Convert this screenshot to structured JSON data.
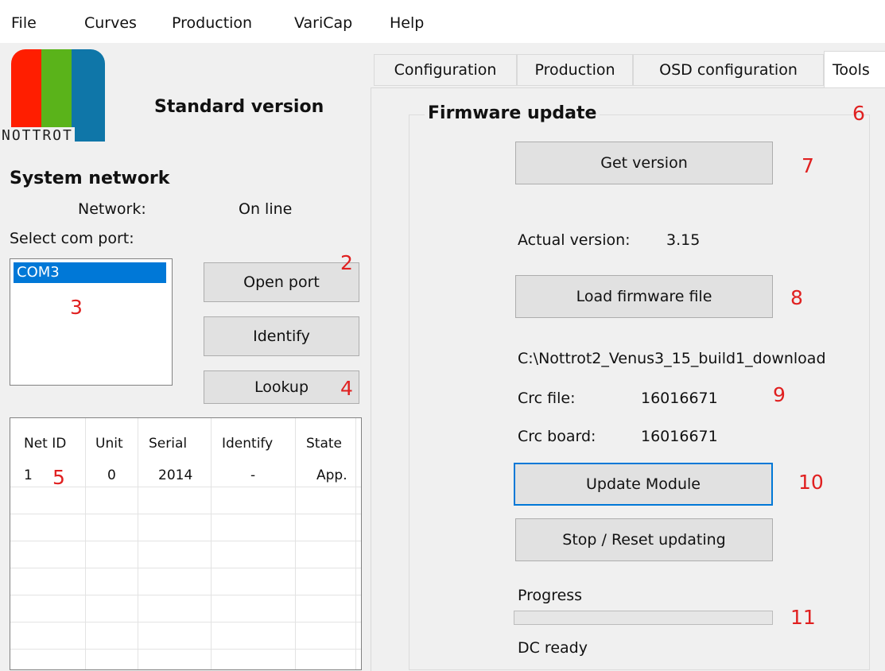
{
  "menu": {
    "items": [
      "File",
      "Curves",
      "Production",
      "VariCap",
      "Help"
    ]
  },
  "logo": {
    "text": "NOTTROT",
    "colors": [
      "#ff1e00",
      "#5ab31a",
      "#0f76a8"
    ]
  },
  "header": {
    "version_label": "Standard version"
  },
  "system_network": {
    "title": "System network",
    "network_label": "Network:",
    "network_status": "On line",
    "select_port_label": "Select com port:",
    "com_ports": [
      "COM3"
    ],
    "selected_port": "COM3",
    "buttons": {
      "open_port": "Open port",
      "identify": "Identify",
      "lookup": "Lookup"
    }
  },
  "net_table": {
    "columns": [
      "Net ID",
      "Unit",
      "Serial",
      "Identify",
      "State"
    ],
    "rows": [
      [
        "1",
        "0",
        "2014",
        "-",
        "App."
      ]
    ]
  },
  "tabs": [
    {
      "label": "Configuration",
      "active": false
    },
    {
      "label": "Production",
      "active": false
    },
    {
      "label": "OSD configuration",
      "active": false
    },
    {
      "label": "Tools",
      "active": true
    }
  ],
  "firmware": {
    "title": "Firmware update",
    "get_version_button": "Get version",
    "actual_version_label": "Actual version:",
    "actual_version_value": "3.15",
    "load_firmware_button": "Load firmware file",
    "file_path": "C:\\Nottrot2_Venus3_15_build1_download",
    "crc_file_label": "Crc file:",
    "crc_file_value": "16016671",
    "crc_board_label": "Crc board:",
    "crc_board_value": "16016671",
    "update_button": "Update Module",
    "stop_button": "Stop / Reset updating",
    "progress_label": "Progress",
    "progress_value": 0,
    "status_text": "DC ready"
  },
  "annotations": {
    "a2": "2",
    "a3": "3",
    "a4": "4",
    "a5": "5",
    "a6": "6",
    "a7": "7",
    "a8": "8",
    "a9": "9",
    "a10": "10",
    "a11": "11"
  },
  "colors": {
    "accent": "#0078d7",
    "annotation": "#e02020",
    "button_face": "#e1e1e1"
  }
}
